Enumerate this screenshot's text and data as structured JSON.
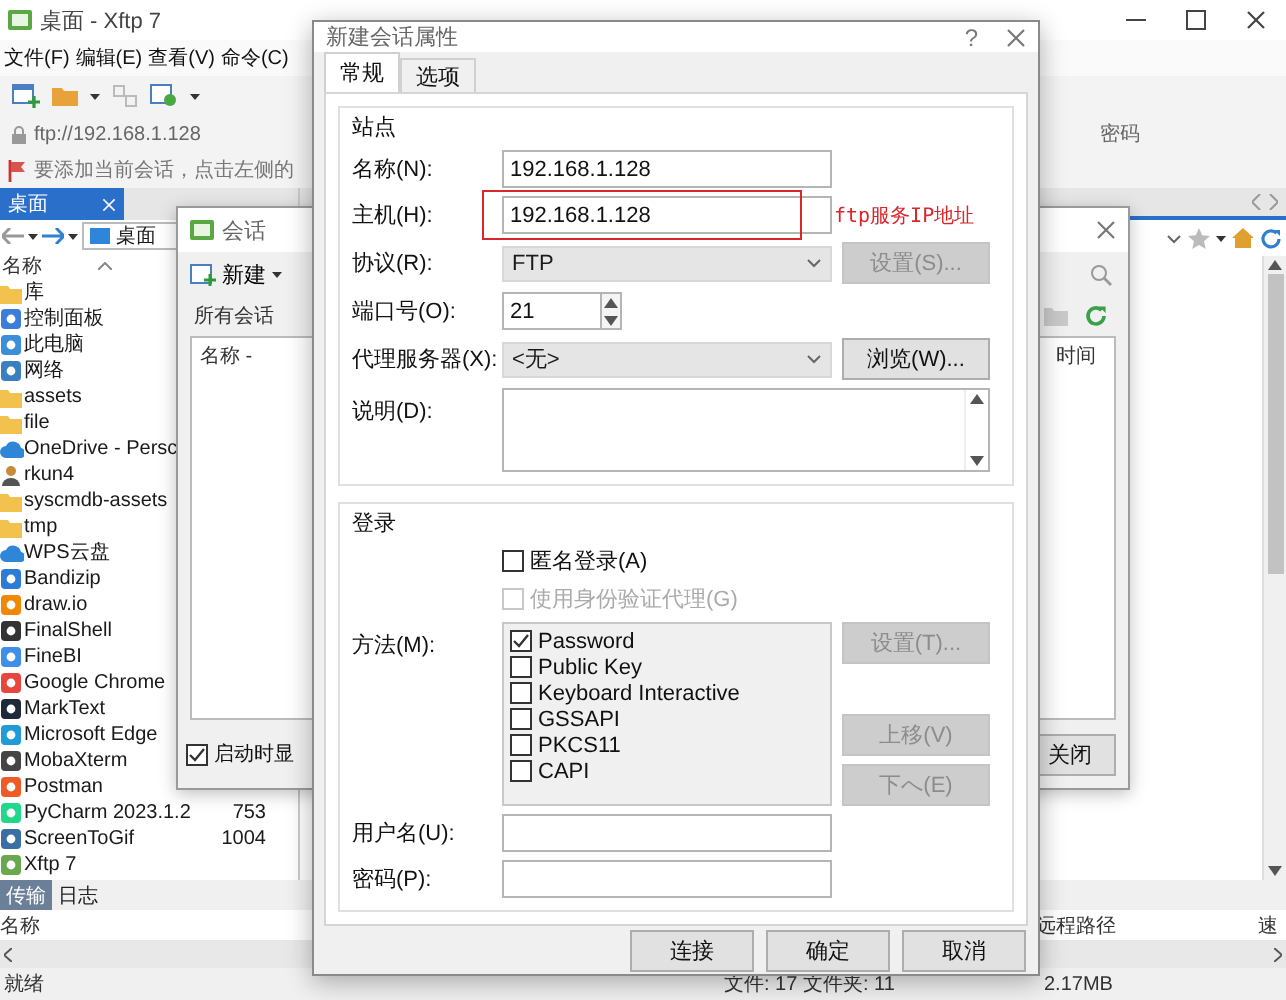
{
  "main_window": {
    "title": "桌面 - Xftp 7",
    "menu": [
      "文件(F)",
      "编辑(E)",
      "查看(V)",
      "命令(C)"
    ],
    "address": "ftp://192.168.1.128",
    "remote_header": "密码",
    "hint": "要添加当前会话，点击左侧的",
    "local_tab": "桌面",
    "local_path": "桌面",
    "column": "名称",
    "files": [
      {
        "name": "库",
        "kind": "folder"
      },
      {
        "name": "控制面板",
        "kind": "app",
        "color": "#3b7dd8"
      },
      {
        "name": "此电脑",
        "kind": "app",
        "color": "#3b8fd8"
      },
      {
        "name": "网络",
        "kind": "app",
        "color": "#3a7fc0"
      },
      {
        "name": "assets",
        "kind": "folder"
      },
      {
        "name": "file",
        "kind": "folder"
      },
      {
        "name": "OneDrive - Persc",
        "kind": "cloud"
      },
      {
        "name": "rkun4",
        "kind": "user"
      },
      {
        "name": "syscmdb-assets",
        "kind": "folder"
      },
      {
        "name": "tmp",
        "kind": "folder"
      },
      {
        "name": "WPS云盘",
        "kind": "cloud"
      },
      {
        "name": "Bandizip",
        "kind": "app",
        "color": "#2c7bd6"
      },
      {
        "name": "draw.io",
        "kind": "app",
        "color": "#f08705"
      },
      {
        "name": "FinalShell",
        "kind": "app",
        "color": "#333333"
      },
      {
        "name": "FineBI",
        "kind": "app",
        "color": "#3f8ee8"
      },
      {
        "name": "Google Chrome",
        "kind": "app",
        "color": "#e8453c"
      },
      {
        "name": "MarkText",
        "kind": "app",
        "color": "#1e2a3a"
      },
      {
        "name": "Microsoft Edge",
        "kind": "app",
        "color": "#1f9cd6"
      },
      {
        "name": "MobaXterm",
        "kind": "app",
        "color": "#444444"
      },
      {
        "name": "Postman",
        "kind": "app",
        "color": "#ef5b25"
      },
      {
        "name": "PyCharm 2023.1.2",
        "size": "753",
        "kind": "app",
        "color": "#21d789"
      },
      {
        "name": "ScreenToGif",
        "size": "1004",
        "kind": "app",
        "color": "#3a6ea5"
      },
      {
        "name": "Xftp 7",
        "kind": "app",
        "color": "#6aa84f"
      }
    ],
    "bottom_tabs": [
      {
        "label": "传输",
        "selected": true
      },
      {
        "label": "日志",
        "selected": false
      }
    ],
    "transfer_columns": [
      "名称",
      "远程路径",
      "速"
    ],
    "status": "就绪",
    "file_counts": "文件: 17 文件夹: 11",
    "total_size": "2.17MB"
  },
  "sessions_dialog": {
    "title": "会话",
    "new_button": "新建",
    "folder": "所有会话",
    "columns": [
      "名称 -",
      "时间"
    ],
    "startup": {
      "label": "启动时显",
      "checked": true
    },
    "close_button": "关闭"
  },
  "properties_dialog": {
    "title": "新建会话属性",
    "help": "?",
    "tabs": [
      {
        "label": "常规",
        "selected": true
      },
      {
        "label": "选项",
        "selected": false
      }
    ],
    "site": {
      "title": "站点",
      "fields": [
        {
          "kind": "text",
          "label": "名称(N):",
          "value": "192.168.1.128"
        },
        {
          "kind": "text",
          "label": "主机(H):",
          "value": "192.168.1.128",
          "annotation": "ftp服务IP地址"
        },
        {
          "kind": "select",
          "label": "协议(R):",
          "value": "FTP",
          "button": {
            "label": "设置(S)...",
            "disabled": true
          }
        },
        {
          "kind": "spinner",
          "label": "端口号(O):",
          "value": "21"
        },
        {
          "kind": "select",
          "label": "代理服务器(X):",
          "value": "<无>",
          "button": {
            "label": "浏览(W)...",
            "disabled": false
          }
        },
        {
          "kind": "textarea",
          "label": "说明(D):"
        }
      ]
    },
    "login": {
      "title": "登录",
      "options": [
        {
          "label": "匿名登录(A)",
          "checked": false,
          "disabled": false
        },
        {
          "label": "使用身份验证代理(G)",
          "checked": false,
          "disabled": true
        }
      ],
      "method_label": "方法(M):",
      "methods": [
        {
          "label": "Password",
          "checked": true
        },
        {
          "label": "Public Key",
          "checked": false
        },
        {
          "label": "Keyboard Interactive",
          "checked": false
        },
        {
          "label": "GSSAPI",
          "checked": false
        },
        {
          "label": "PKCS11",
          "checked": false
        },
        {
          "label": "CAPI",
          "checked": false
        }
      ],
      "method_buttons": [
        {
          "label": "设置(T)...",
          "disabled": true
        },
        {
          "label": "上移(V)",
          "disabled": true
        },
        {
          "label": "下へ(E)",
          "disabled": true
        }
      ],
      "credentials": [
        {
          "label": "用户名(U):"
        },
        {
          "label": "密码(P):"
        }
      ]
    },
    "buttons": [
      "连接",
      "确定",
      "取消"
    ]
  }
}
